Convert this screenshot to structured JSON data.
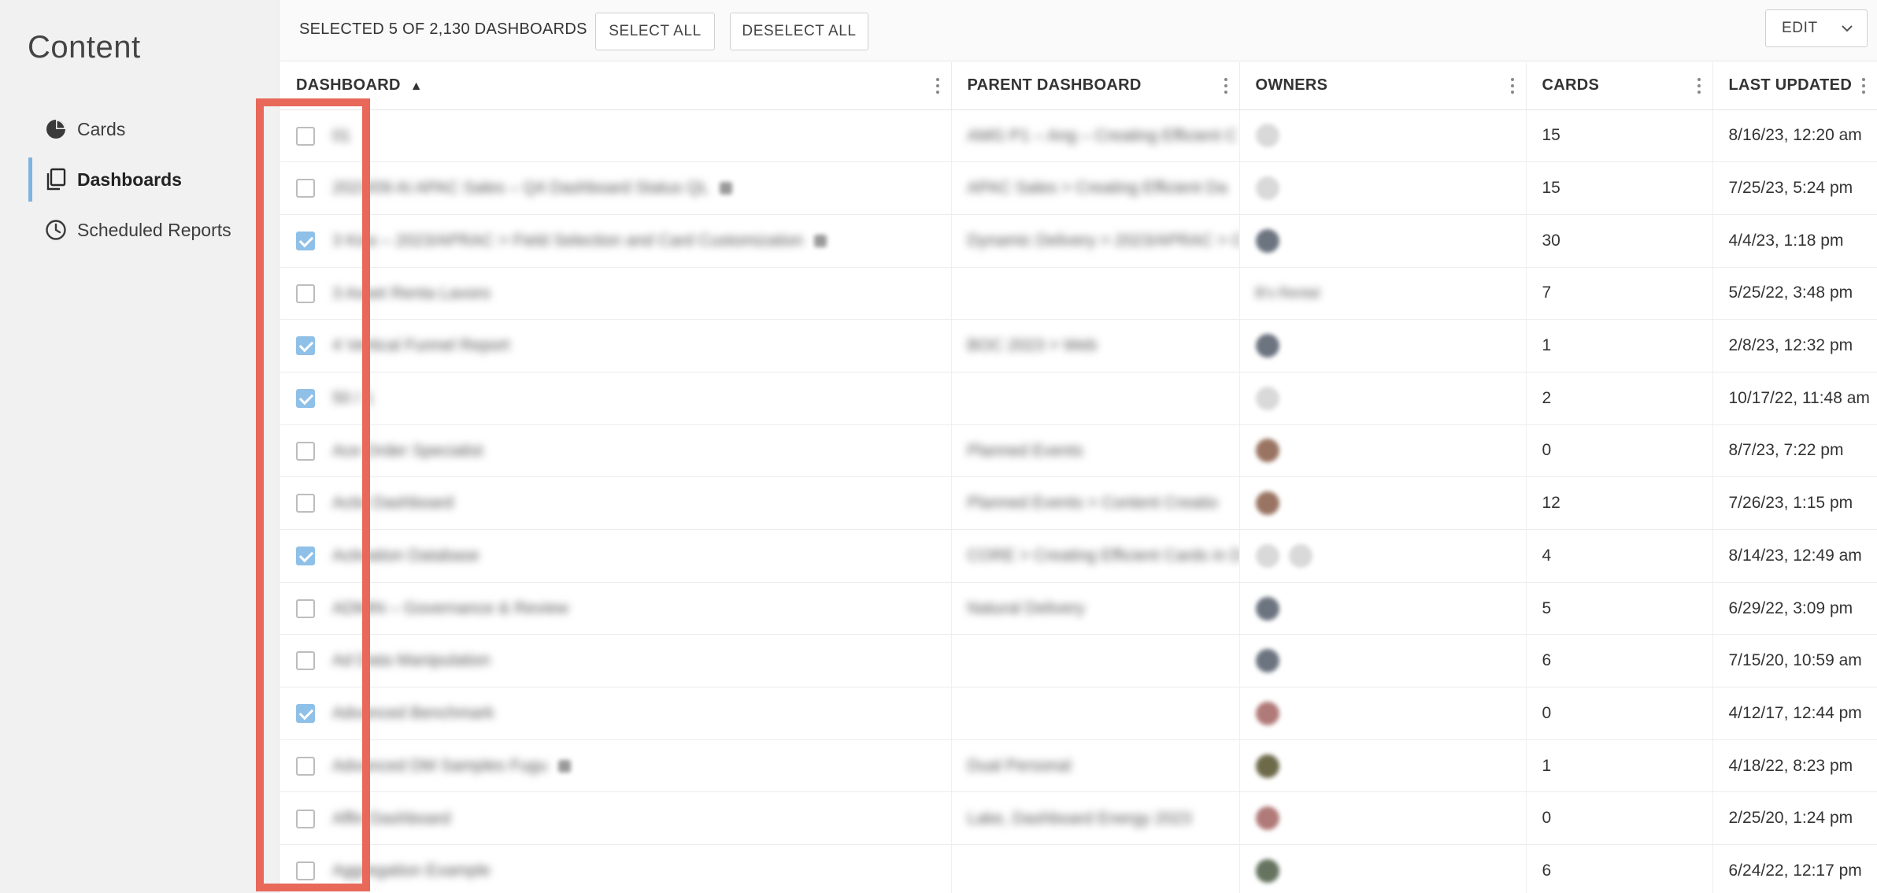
{
  "sidebar": {
    "title": "Content",
    "items": [
      {
        "label": "Cards",
        "icon": "pie-chart-icon",
        "active": false
      },
      {
        "label": "Dashboards",
        "icon": "dashboards-icon",
        "active": true
      },
      {
        "label": "Scheduled Reports",
        "icon": "clock-icon",
        "active": false
      }
    ]
  },
  "toolbar": {
    "selection_text": "SELECTED 5 OF 2,130 DASHBOARDS",
    "select_all_label": "SELECT ALL",
    "deselect_all_label": "DESELECT ALL",
    "edit_label": "EDIT"
  },
  "table": {
    "columns": [
      "DASHBOARD",
      "PARENT DASHBOARD",
      "OWNERS",
      "CARDS",
      "LAST UPDATED"
    ],
    "sort_indicator": "▲",
    "rows": [
      {
        "checked": false,
        "name": "01",
        "parent": "AMG P1 – Ang – Creating Efficient C",
        "owners": [
          "light"
        ],
        "cards": "15",
        "updated": "8/16/23, 12:20 am",
        "icon": false
      },
      {
        "checked": false,
        "name": "2023/09 AI APAC Sales – Q4 Dashboard Status QL",
        "parent": "APAC Sales > Creating Efficient Da",
        "owners": [
          "light"
        ],
        "cards": "15",
        "updated": "7/25/23, 5:24 pm",
        "icon": true
      },
      {
        "checked": true,
        "name": "3 Kiss – 2023/APRAC > Field Selection and Card Customization",
        "parent": "Dynamic Delivery > 2023/APRAC > C",
        "owners": [
          "dark"
        ],
        "cards": "30",
        "updated": "4/4/23, 1:18 pm",
        "icon": true
      },
      {
        "checked": false,
        "name": "3 Asset Renta Lavoro",
        "parent": "",
        "owners": [],
        "owner_text": "B's Rental",
        "cards": "7",
        "updated": "5/25/22, 3:48 pm",
        "icon": false
      },
      {
        "checked": true,
        "name": "4 Vertical Funnel Report",
        "parent": "BOC 2023 > Web",
        "owners": [
          "dark"
        ],
        "cards": "1",
        "updated": "2/8/23, 12:32 pm",
        "icon": false
      },
      {
        "checked": true,
        "name": "50 / 1",
        "parent": "",
        "owners": [
          "light"
        ],
        "cards": "2",
        "updated": "10/17/22, 11:48 am",
        "icon": false
      },
      {
        "checked": false,
        "name": "Ace Order Specialist",
        "parent": "Planned Events",
        "owners": [
          "warm"
        ],
        "cards": "0",
        "updated": "8/7/23, 7:22 pm",
        "icon": false
      },
      {
        "checked": false,
        "name": "Actix Dashboard",
        "parent": "Planned Events > Content Creatio",
        "owners": [
          "warm"
        ],
        "cards": "12",
        "updated": "7/26/23, 1:15 pm",
        "icon": false
      },
      {
        "checked": true,
        "name": "Activation Database",
        "parent": "CORE > Creating Efficient Cards in D",
        "owners": [
          "light",
          "light"
        ],
        "cards": "4",
        "updated": "8/14/23, 12:49 am",
        "icon": false
      },
      {
        "checked": false,
        "name": "ADMIN – Governance & Review",
        "parent": "Natural Delivery",
        "owners": [
          "dark"
        ],
        "cards": "5",
        "updated": "6/29/22, 3:09 pm",
        "icon": false
      },
      {
        "checked": false,
        "name": "Ad Data Manipulation",
        "parent": "",
        "owners": [
          "dark"
        ],
        "cards": "6",
        "updated": "7/15/20, 10:59 am",
        "icon": false
      },
      {
        "checked": true,
        "name": "Advanced Benchmark",
        "parent": "",
        "owners": [
          "rose"
        ],
        "cards": "0",
        "updated": "4/12/17, 12:44 pm",
        "icon": false
      },
      {
        "checked": false,
        "name": "Advanced DM Samples Fugu",
        "parent": "Dual Personal",
        "owners": [
          "olive"
        ],
        "cards": "1",
        "updated": "4/18/22, 8:23 pm",
        "icon": true
      },
      {
        "checked": false,
        "name": "Affin Dashboard",
        "parent": "Lake, Dashboard Energy 2023",
        "owners": [
          "rose"
        ],
        "cards": "0",
        "updated": "2/25/20, 1:24 pm",
        "icon": false
      },
      {
        "checked": false,
        "name": "Aggregation Example",
        "parent": "",
        "owners": [
          "green"
        ],
        "cards": "6",
        "updated": "6/24/22, 12:17 pm",
        "icon": false
      }
    ]
  },
  "colors": {
    "accent": "#8fc0e8",
    "highlight": "#e8685a",
    "sidebar_bg": "#f1f1f1"
  }
}
